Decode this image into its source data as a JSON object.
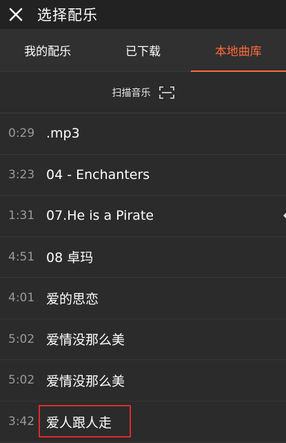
{
  "header": {
    "close_icon": "close-icon",
    "title": "选择配乐"
  },
  "tabs": [
    {
      "label": "我的配乐",
      "active": false
    },
    {
      "label": "已下载",
      "active": false
    },
    {
      "label": "本地曲库",
      "active": true
    }
  ],
  "scan": {
    "label": "扫描音乐",
    "icon": "scan-frame-icon"
  },
  "colors": {
    "accent": "#ff6a3a",
    "highlight_border": "#e02b2b",
    "background": "#2b2b2b"
  },
  "songs": [
    {
      "duration": "0:29",
      "title": ".mp3"
    },
    {
      "duration": "3:23",
      "title": "04 - Enchanters"
    },
    {
      "duration": "1:31",
      "title": "07.He is a Pirate"
    },
    {
      "duration": "4:51",
      "title": "08 卓玛"
    },
    {
      "duration": "4:01",
      "title": "爱的思恋"
    },
    {
      "duration": "5:02",
      "title": "爱情没那么美"
    },
    {
      "duration": "5:02",
      "title": "爱情没那么美"
    },
    {
      "duration": "3:42",
      "title": "爱人跟人走",
      "highlighted": true
    }
  ]
}
